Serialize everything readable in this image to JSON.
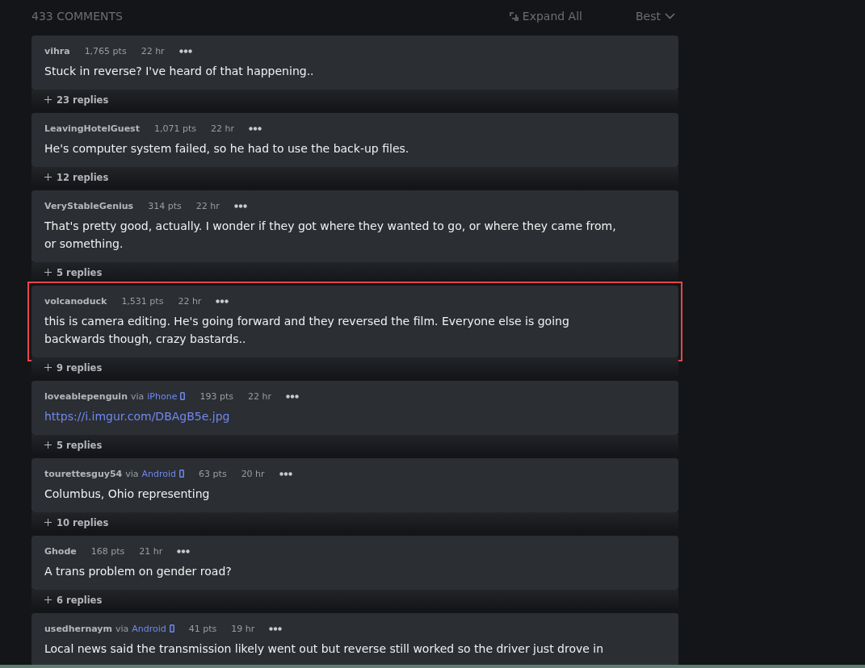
{
  "header": {
    "count": "433 COMMENTS",
    "expand": "Expand All",
    "sort": "Best"
  },
  "comments": [
    {
      "user": "vihra",
      "points": "1,765 pts",
      "time": "22 hr",
      "text": "Stuck in reverse? I've heard of that happening..",
      "replies": "23 replies",
      "highlighted": false
    },
    {
      "user": "LeavingHotelGuest",
      "points": "1,071 pts",
      "time": "22 hr",
      "text": "He's computer system failed, so he had to use the back-up files.",
      "replies": "12 replies",
      "highlighted": false
    },
    {
      "user": "VeryStableGenius",
      "points": "314 pts",
      "time": "22 hr",
      "text": "That's pretty good, actually. I wonder if they got where they wanted to go, or where they came from, or something.",
      "replies": "5 replies",
      "highlighted": false
    },
    {
      "user": "volcanoduck",
      "points": "1,531 pts",
      "time": "22 hr",
      "text": "this is camera editing. He's going forward and they reversed the film. Everyone else is going backwards though, crazy bastards..",
      "replies": "9 replies",
      "highlighted": true
    },
    {
      "user": "loveablepenguin",
      "via": "via",
      "device": "iPhone",
      "points": "193 pts",
      "time": "22 hr",
      "text": "https://i.imgur.com/DBAgB5e.jpg",
      "kind": "link",
      "replies": "5 replies",
      "highlighted": false
    },
    {
      "user": "tourettesguy54",
      "via": "via",
      "device": "Android",
      "points": "63 pts",
      "time": "20 hr",
      "text": "Columbus, Ohio representing",
      "replies": "10 replies",
      "highlighted": false
    },
    {
      "user": "Ghode",
      "points": "168 pts",
      "time": "21 hr",
      "text": "A trans problem on gender road?",
      "replies": "6 replies",
      "highlighted": false
    },
    {
      "user": "usedhernaym",
      "via": "via",
      "device": "Android",
      "points": "41 pts",
      "time": "19 hr",
      "text": "Local news said the transmission likely went out but reverse still worked so the driver just drove in",
      "highlighted": false
    }
  ]
}
